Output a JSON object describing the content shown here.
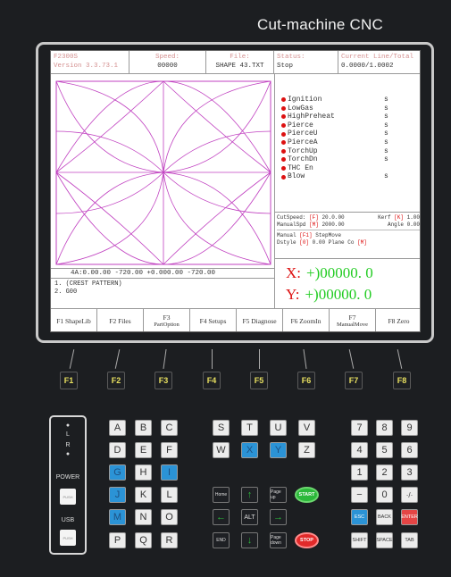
{
  "brand": "Cut-machine CNC",
  "status_bar": [
    {
      "label": "F2300S",
      "value": "Version 3.3.73.1"
    },
    {
      "label": "Speed:",
      "value": "00000"
    },
    {
      "label": "File:",
      "value": "SHAPE 43.TXT"
    },
    {
      "label": "Status:",
      "value": "Stop"
    },
    {
      "label": "Current Line/Total",
      "value": "0.0000/1.0002"
    }
  ],
  "coords_line": "4A:0.00.00    -720.00    +0.000.00    -720.00",
  "program_lines": [
    "1. (CREST PATTERN)",
    "2. G00"
  ],
  "io_status": [
    {
      "name": "Ignition",
      "unit": "s"
    },
    {
      "name": "LowGas",
      "unit": "s"
    },
    {
      "name": "HighPreheat",
      "unit": "s"
    },
    {
      "name": "Pierce",
      "unit": "s"
    },
    {
      "name": "PierceU",
      "unit": "s"
    },
    {
      "name": "PierceA",
      "unit": "s"
    },
    {
      "name": "TorchUp",
      "unit": "s"
    },
    {
      "name": "TorchDn",
      "unit": "s"
    },
    {
      "name": "THC En",
      "unit": ""
    },
    {
      "name": "Blow",
      "unit": "s"
    }
  ],
  "params": {
    "row1": {
      "label": "CutSpeed:",
      "tag": "[F]",
      "val": "20.0.00",
      "label2": "Kerf",
      "tag2": "[K]",
      "val2": "1.00"
    },
    "row2": {
      "label": "ManualSpd",
      "tag": "[M]",
      "val": "2000.00",
      "label2": "Angle",
      "val2": "0.00"
    },
    "row3": {
      "label": "Manual",
      "tag": "[F1]",
      "val": "StepMove"
    },
    "row4": {
      "label": "Dstyle",
      "tag": "[0]",
      "val": "0.00",
      "label2": "Plane Co",
      "tag2": "[M]"
    }
  },
  "x_display": {
    "axis": "X:",
    "value": "+)00000. 0"
  },
  "y_display": {
    "axis": "Y:",
    "value": "+)00000. 0"
  },
  "function_keys": [
    {
      "top": "F1 ShapeLib",
      "sub": ""
    },
    {
      "top": "F2 Files",
      "sub": ""
    },
    {
      "top": "F3",
      "sub": "PartOption"
    },
    {
      "top": "F4 Setups",
      "sub": ""
    },
    {
      "top": "F5 Diagnose",
      "sub": ""
    },
    {
      "top": "F6 ZoomIn",
      "sub": ""
    },
    {
      "top": "F7",
      "sub": "ManualMove"
    },
    {
      "top": "F8 Zero",
      "sub": ""
    }
  ],
  "f_buttons": [
    "F1",
    "F2",
    "F3",
    "F4",
    "F5",
    "F6",
    "F7",
    "F8"
  ],
  "side_panel": {
    "ind1": "L",
    "ind2": "R",
    "power_label": "POWER",
    "power_btn": "PUSH",
    "usb_label": "USB",
    "usb_btn": "PUSH"
  },
  "letter_keys": [
    "A",
    "B",
    "C",
    "D",
    "E",
    "F",
    "G",
    "H",
    "I",
    "J",
    "K",
    "L",
    "M",
    "N",
    "O",
    "P",
    "Q",
    "R"
  ],
  "axis_keys": [
    "S",
    "T",
    "U",
    "V",
    "W",
    "X",
    "Y",
    "Z"
  ],
  "nav": {
    "home": "Home",
    "page_up": "Page up",
    "alt": "ALT",
    "end": "END",
    "page_down": "Page down",
    "up": "↑",
    "down": "↓",
    "left": "←",
    "right": "→",
    "start": "START",
    "stop": "STOP"
  },
  "numpad": [
    "7",
    "8",
    "9",
    "4",
    "5",
    "6",
    "1",
    "2",
    "3",
    "−",
    "0",
    "·/·"
  ],
  "bottom_keys": [
    "ESC",
    "BACK",
    "ENTER",
    "SHIFT",
    "SPACE",
    "TAB"
  ]
}
